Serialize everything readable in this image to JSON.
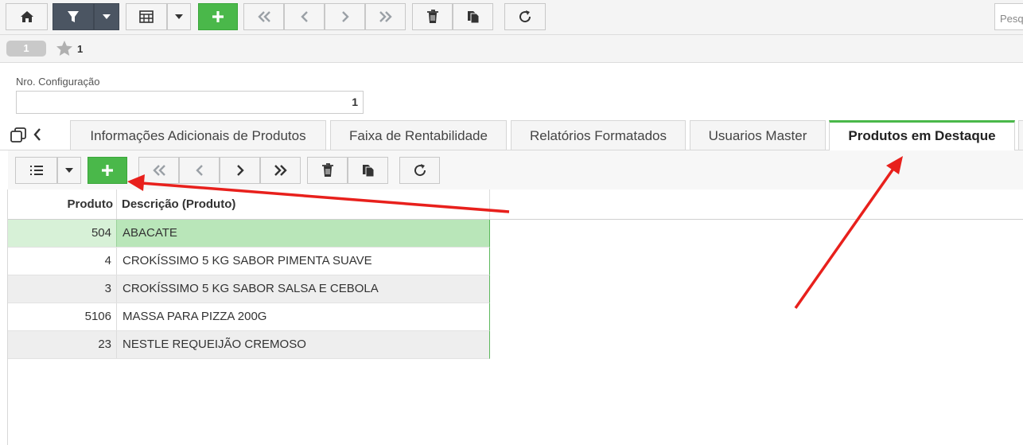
{
  "toolbar": {
    "buttons": [
      "home",
      "filter",
      "grid-view",
      "add",
      "first",
      "previous",
      "next",
      "last",
      "delete",
      "copy",
      "refresh"
    ],
    "search_placeholder": "Pesq"
  },
  "record": {
    "badge": "1",
    "favorite_label": "1"
  },
  "form": {
    "nro_config_label": "Nro. Configuração",
    "nro_config_value": "1"
  },
  "tabs": [
    {
      "label": "Informações Adicionais de Produtos",
      "active": false
    },
    {
      "label": "Faixa de Rentabilidade",
      "active": false
    },
    {
      "label": "Relatórios Formatados",
      "active": false
    },
    {
      "label": "Usuarios Master",
      "active": false
    },
    {
      "label": "Produtos em Destaque",
      "active": true
    }
  ],
  "grid": {
    "columns": [
      "Produto",
      "Descrição (Produto)"
    ],
    "rows": [
      {
        "produto": "504",
        "descricao": "ABACATE",
        "selected": true
      },
      {
        "produto": "4",
        "descricao": "CROKÍSSIMO 5 KG SABOR PIMENTA SUAVE"
      },
      {
        "produto": "3",
        "descricao": "CROKÍSSIMO 5 KG SABOR SALSA E CEBOLA"
      },
      {
        "produto": "5106",
        "descricao": "MASSA PARA PIZZA 200G"
      },
      {
        "produto": "23",
        "descricao": "NESTLE REQUEIJÃO CREMOSO"
      }
    ]
  },
  "colors": {
    "accent_green": "#4ab84a",
    "selected_row": "#b9e6b9",
    "annotation_arrow": "#e8201c"
  }
}
